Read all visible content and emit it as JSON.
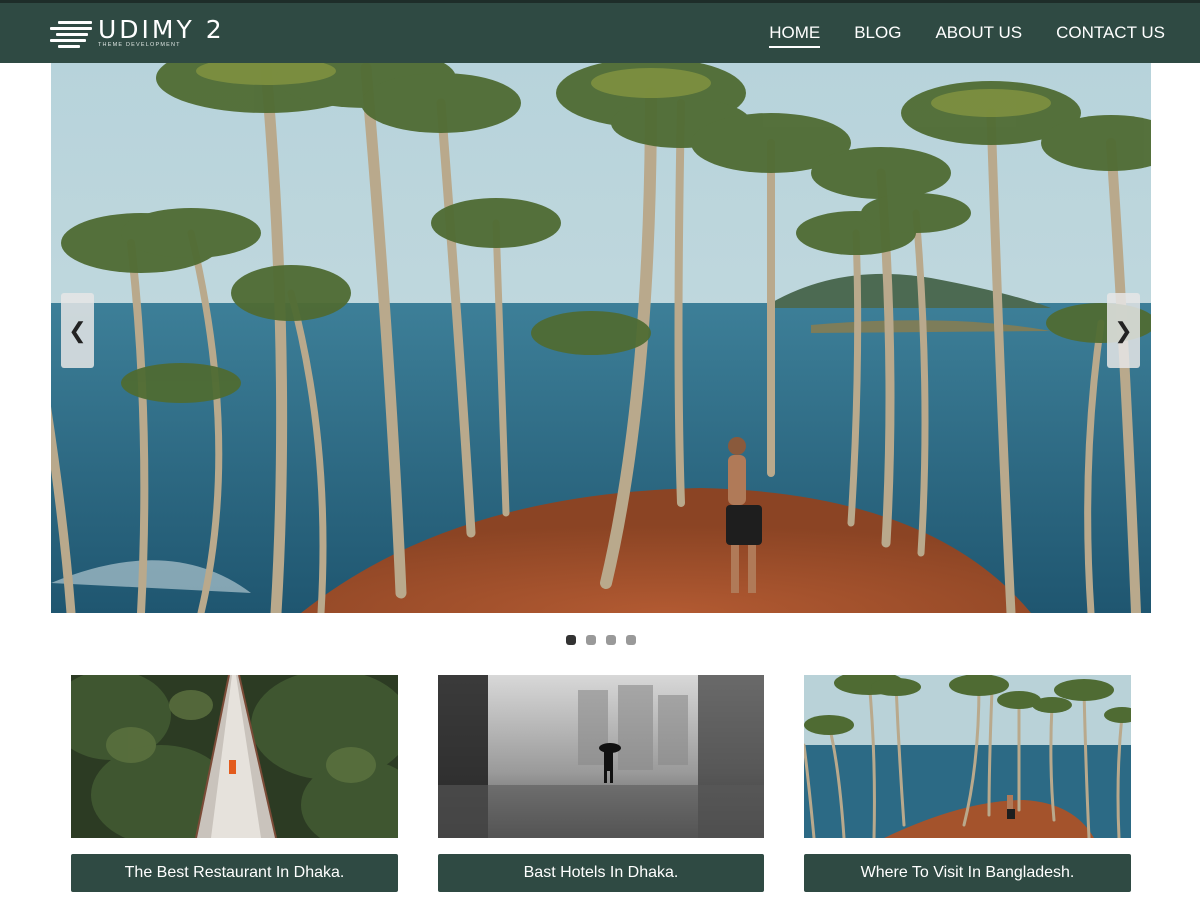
{
  "header": {
    "logo": {
      "name": "UDIMY 2",
      "tagline": "THEME DEVELOPMENT",
      "icon": "lines-logo-icon"
    },
    "nav": [
      {
        "label": "HOME",
        "active": true
      },
      {
        "label": "BLOG",
        "active": false
      },
      {
        "label": "ABOUT US",
        "active": false
      },
      {
        "label": "CONTACT US",
        "active": false
      }
    ]
  },
  "slider": {
    "prev_icon": "❮",
    "next_icon": "❯",
    "slides": 4,
    "active_slide": 1
  },
  "cards": [
    {
      "title": "The Best Restaurant In Dhaka.",
      "image": "forest-bridge"
    },
    {
      "title": "Bast Hotels In Dhaka.",
      "image": "foggy-city-umbrella"
    },
    {
      "title": "Where To Visit In Bangladesh.",
      "image": "palm-island"
    }
  ],
  "colors": {
    "brand": "#2f4a43",
    "white": "#ffffff"
  }
}
